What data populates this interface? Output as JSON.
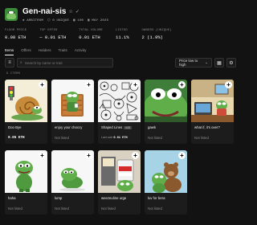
{
  "collection": {
    "name": "Gen-nai-sis",
    "chain": "ARBITRUM",
    "unique_label": "0 UNIQUE",
    "items_label": "100",
    "mint_label": "MAY 2025"
  },
  "stats": [
    {
      "label": "FLOOR PRICE",
      "value": "0.08 ETH"
    },
    {
      "label": "TOP OFFER",
      "value": "— 0.01 ETH"
    },
    {
      "label": "TOTAL VOLUME",
      "value": "0.01 ETH"
    },
    {
      "label": "LISTED",
      "value": "11.1%"
    },
    {
      "label": "OWNERS (UNIQUE)",
      "value": "2 (1.9%)"
    }
  ],
  "tabs": [
    "Items",
    "Offers",
    "Holders",
    "Traits",
    "Activity"
  ],
  "toolbar": {
    "search_placeholder": "Search by name or trait",
    "sort_label": "Price low to high"
  },
  "item_count": "9 ITEMS",
  "items": [
    {
      "name": "Doo Bye",
      "price": "0.05 ETH",
      "status": "listed"
    },
    {
      "name": "enjoy your choccy",
      "price": "Not listed",
      "status": "unlisted"
    },
    {
      "name": "Shaped Lines",
      "badge": "x10",
      "last_sale_label": "Last sale",
      "last_sale_value": "0.01 ETH",
      "status": "lastsale"
    },
    {
      "name": "gawk",
      "price": "Not listed",
      "status": "unlisted"
    },
    {
      "name": "what if, it's over?",
      "price": "Not listed",
      "status": "unlisted"
    },
    {
      "name": "haha",
      "price": "Not listed",
      "status": "unlisted"
    },
    {
      "name": "lump",
      "price": "Not listed",
      "status": "unlisted"
    },
    {
      "name": "weezeuline urge",
      "price": "Not listed",
      "status": "unlisted"
    },
    {
      "name": "luv for bera",
      "price": "Not listed",
      "status": "unlisted"
    }
  ],
  "colors": {
    "background": "#121212",
    "card": "#1c1c1c",
    "pepe_green": "#5fae4a"
  },
  "icons": [
    "star-icon",
    "verified-icon",
    "filter-icon",
    "search-icon",
    "chevron-down-icon",
    "grid-view-icon",
    "settings-icon",
    "plus-icon"
  ]
}
